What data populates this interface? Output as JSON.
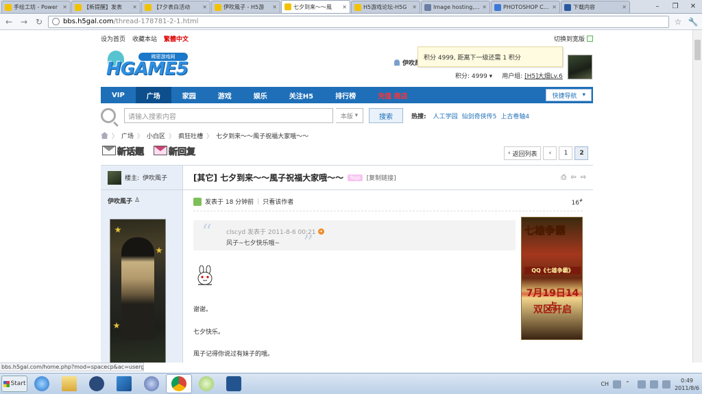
{
  "browser": {
    "tabs": [
      {
        "title": "手绘工坊 - Power",
        "color": "#f2c200",
        "active": false
      },
      {
        "title": "【新提醒】发表",
        "color": "#f2c200",
        "active": false
      },
      {
        "title": "【7夕表白活动",
        "color": "#f2c200",
        "active": false
      },
      {
        "title": "伊吹風子 - H5游",
        "color": "#f2c200",
        "active": false
      },
      {
        "title": "七夕到来～～風",
        "color": "#f2c200",
        "active": true
      },
      {
        "title": "H5游戏论坛-H5G",
        "color": "#f2c200",
        "active": false
      },
      {
        "title": "Image hosting, fr",
        "color": "#6a7ea6",
        "active": false
      },
      {
        "title": "PHOTOSHOP CS4",
        "color": "#3c78d8",
        "active": false
      },
      {
        "title": "下载内容",
        "color": "#2a5aa0",
        "active": false
      }
    ],
    "url_host": "bbs.h5gal.com",
    "url_path": "/thread-178781-2-1.html",
    "status_url": "bbs.h5gal.com/home.php?mod=spacecp&ac=usergroup"
  },
  "topbar": {
    "set_home": "设为首页",
    "bookmark": "收藏本站",
    "traditional": "繁體中文",
    "switch_width": "切换到宽版"
  },
  "logo": {
    "badge": "稀密游戏网",
    "word": "HGAME5"
  },
  "user": {
    "name": "伊吹風",
    "tooltip": "积分 4999, 距离下一级还需 1 积分",
    "credits": "积分: 4999",
    "usergroup_label": "用户组:",
    "usergroup": "[H5]大畑Lv.6"
  },
  "nav": {
    "items": [
      {
        "label": "VIP",
        "active": false,
        "hot": false
      },
      {
        "label": "广场",
        "active": true,
        "hot": false
      },
      {
        "label": "家园",
        "active": false,
        "hot": false
      },
      {
        "label": "游戏",
        "active": false,
        "hot": false
      },
      {
        "label": "娱乐",
        "active": false,
        "hot": false
      },
      {
        "label": "关注H5",
        "active": false,
        "hot": false
      },
      {
        "label": "排行榜",
        "active": false,
        "hot": false
      },
      {
        "label": "充值 商店",
        "active": false,
        "hot": true
      }
    ],
    "quick": "快捷导航"
  },
  "search": {
    "placeholder": "请输入搜索内容",
    "scope": "本版",
    "button": "搜索",
    "hot_label": "热搜:",
    "hot": [
      "人工学园",
      "仙剑奇侠传5",
      "上古卷轴4"
    ]
  },
  "breadcrumb": [
    "广场",
    "小白区",
    "疯狂吐槽",
    "七夕到来～～風子祝福大家哦～～"
  ],
  "actions": {
    "new_thread": "新话题",
    "reply": "新回复"
  },
  "pager": {
    "back": "返回列表",
    "prev": "‹",
    "pages": [
      "1",
      "2"
    ],
    "current": "2"
  },
  "thread": {
    "op_label": "楼主:",
    "op_name": "伊吹風子",
    "poster_name": "伊吹風子",
    "title": "[其它] 七夕到来～～風子祝福大家哦～～",
    "tag": "Tags",
    "copy": "[复制链接]",
    "posted": "发表于 18 分钟前",
    "only_author": "只看该作者",
    "floor": "16",
    "quote": {
      "author": "clscyd 发表于 2011-8-6 00:21",
      "text": "风子~七夕快乐哦~"
    },
    "lines": [
      "谢谢。",
      "七夕快乐。",
      "風子记得你说过有妹子的哦。"
    ]
  },
  "ad": {
    "title": "七雄争霸",
    "sub": "QQ《七雄争霸》",
    "date": "7月19日14点",
    "open": "双区开启"
  },
  "taskbar": {
    "start": "Start",
    "lang": "CH",
    "time": "0:49",
    "date": "2011/8/6"
  }
}
